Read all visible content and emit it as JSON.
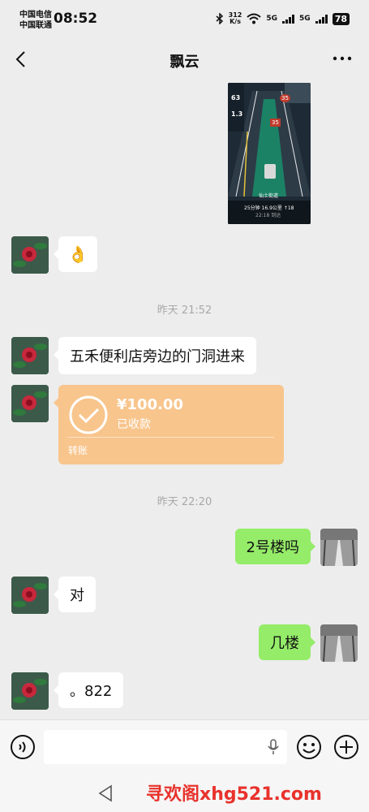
{
  "status_bar": {
    "carrier_1": "中国电信",
    "carrier_2": "中国联通",
    "time": "08:52",
    "net_speed_value": "312",
    "net_speed_unit": "K/s",
    "network_1": "5G",
    "network_2": "5G",
    "battery": "78"
  },
  "header": {
    "title": "飘云"
  },
  "messages": {
    "ok_emoji": "👌",
    "timestamp_1": "昨天 21:52",
    "text_1": "五禾便利店旁边的门洞进来",
    "transfer": {
      "amount": "¥100.00",
      "status": "已收款",
      "label": "转账"
    },
    "timestamp_2": "昨天 22:20",
    "me_1": "2号楼吗",
    "reply_1": "对",
    "me_2": "几楼",
    "reply_2": "。822"
  },
  "nav_screenshot": {
    "speed": "63",
    "dist": "1.3",
    "limit_1": "35",
    "limit_2": "35",
    "road": "仙土街道",
    "eta": "25分钟 16.9公里 ↑18",
    "arrive": "22:18 到达"
  },
  "footer": {
    "watermark": "寻欢阁xhg521.com"
  },
  "colors": {
    "background": "#ededed",
    "my_bubble": "#95ec69",
    "transfer_card": "#f8c58d",
    "watermark": "#e8322c"
  }
}
